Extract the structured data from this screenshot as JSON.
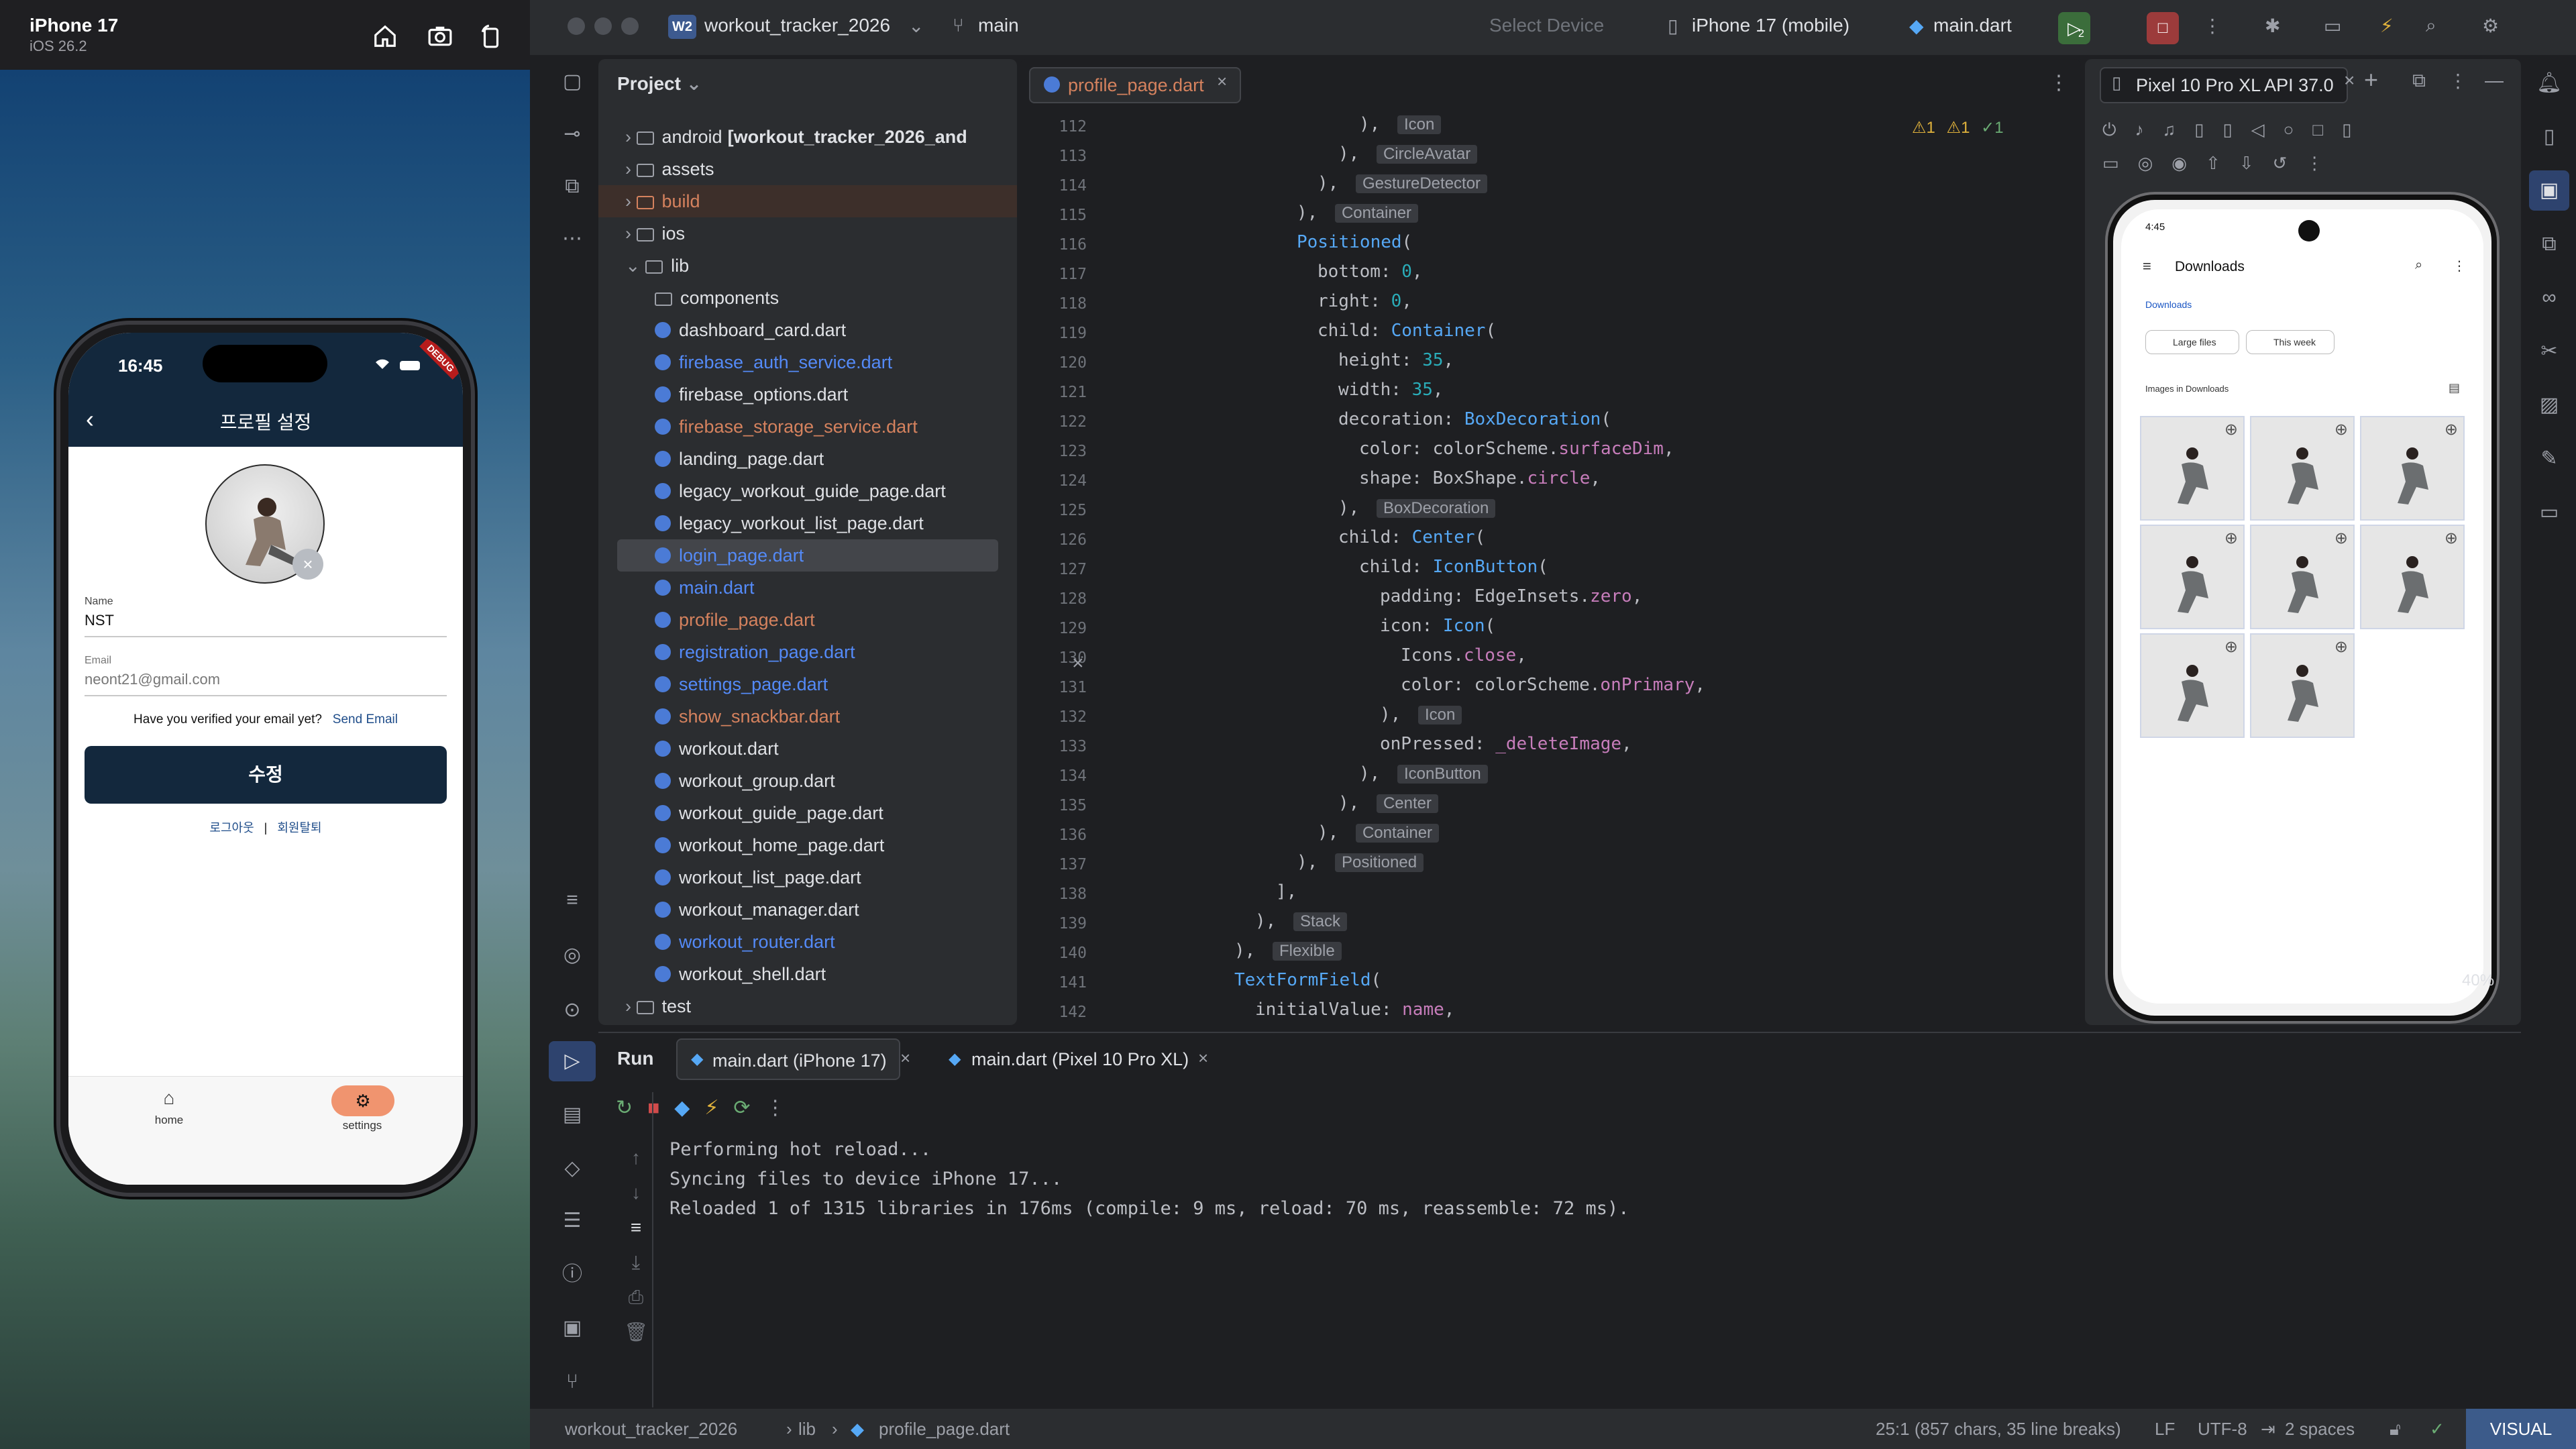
{
  "simulator": {
    "device_name": "iPhone 17",
    "os_version": "iOS 26.2",
    "app": {
      "time": "16:45",
      "debug_banner": "DEBUG",
      "title": "프로필 설정",
      "name_label": "Name",
      "name_value": "NST",
      "email_label": "Email",
      "email_value": "neont21@gmail.com",
      "verify_text": "Have you verified your email yet?",
      "send_email": "Send Email",
      "edit_button": "수정",
      "logout": "로그아웃",
      "separator": "|",
      "withdraw": "회원탈퇴",
      "tabs": [
        {
          "label": "home",
          "icon": "home-icon"
        },
        {
          "label": "settings",
          "icon": "gear-icon"
        }
      ]
    }
  },
  "ide": {
    "project_badge": "W2",
    "project_name": "workout_tracker_2026",
    "branch": "main",
    "select_device": "Select Device",
    "device": "iPhone 17 (mobile)",
    "run_config": "main.dart",
    "badge_count": "2",
    "project_panel": {
      "title": "Project",
      "items": [
        {
          "label": "android",
          "suffix": "[workout_tracker_2026_and",
          "type": "folder",
          "depth": 1,
          "style": "plain"
        },
        {
          "label": "assets",
          "type": "folder",
          "depth": 1,
          "style": "plain"
        },
        {
          "label": "build",
          "type": "folder",
          "depth": 1,
          "style": "orange"
        },
        {
          "label": "ios",
          "type": "folder",
          "depth": 1,
          "style": "plain"
        },
        {
          "label": "lib",
          "type": "folder",
          "depth": 1,
          "style": "plain",
          "open": true
        },
        {
          "label": "components",
          "type": "folder",
          "depth": 2,
          "style": "plain"
        },
        {
          "label": "dashboard_card.dart",
          "type": "dart",
          "depth": 2,
          "style": "plain"
        },
        {
          "label": "firebase_auth_service.dart",
          "type": "dart",
          "depth": 2,
          "style": "blue"
        },
        {
          "label": "firebase_options.dart",
          "type": "dart",
          "depth": 2,
          "style": "plain"
        },
        {
          "label": "firebase_storage_service.dart",
          "type": "dart",
          "depth": 2,
          "style": "mod"
        },
        {
          "label": "landing_page.dart",
          "type": "dart",
          "depth": 2,
          "style": "plain"
        },
        {
          "label": "legacy_workout_guide_page.dart",
          "type": "dart",
          "depth": 2,
          "style": "plain"
        },
        {
          "label": "legacy_workout_list_page.dart",
          "type": "dart",
          "depth": 2,
          "style": "plain"
        },
        {
          "label": "login_page.dart",
          "type": "dart",
          "depth": 2,
          "style": "blue",
          "selected": true
        },
        {
          "label": "main.dart",
          "type": "dart",
          "depth": 2,
          "style": "blue"
        },
        {
          "label": "profile_page.dart",
          "type": "dart",
          "depth": 2,
          "style": "mod"
        },
        {
          "label": "registration_page.dart",
          "type": "dart",
          "depth": 2,
          "style": "blue"
        },
        {
          "label": "settings_page.dart",
          "type": "dart",
          "depth": 2,
          "style": "blue"
        },
        {
          "label": "show_snackbar.dart",
          "type": "dart",
          "depth": 2,
          "style": "mod"
        },
        {
          "label": "workout.dart",
          "type": "dart",
          "depth": 2,
          "style": "plain"
        },
        {
          "label": "workout_group.dart",
          "type": "dart",
          "depth": 2,
          "style": "plain"
        },
        {
          "label": "workout_guide_page.dart",
          "type": "dart",
          "depth": 2,
          "style": "plain"
        },
        {
          "label": "workout_home_page.dart",
          "type": "dart",
          "depth": 2,
          "style": "plain"
        },
        {
          "label": "workout_list_page.dart",
          "type": "dart",
          "depth": 2,
          "style": "plain"
        },
        {
          "label": "workout_manager.dart",
          "type": "dart",
          "depth": 2,
          "style": "plain"
        },
        {
          "label": "workout_router.dart",
          "type": "dart",
          "depth": 2,
          "style": "blue"
        },
        {
          "label": "workout_shell.dart",
          "type": "dart",
          "depth": 2,
          "style": "plain"
        },
        {
          "label": "test",
          "type": "folder",
          "depth": 1,
          "style": "plain"
        }
      ]
    },
    "editor": {
      "tab": "profile_page.dart",
      "inspections": {
        "warn1": "1",
        "warn2": "1",
        "ok": "1"
      },
      "lines": [
        "112",
        "113",
        "114",
        "115",
        "116",
        "117",
        "118",
        "119",
        "120",
        "121",
        "122",
        "123",
        "124",
        "125",
        "126",
        "127",
        "128",
        "129",
        "130",
        "131",
        "132",
        "133",
        "134",
        "135",
        "136",
        "137",
        "138",
        "139",
        "140",
        "141",
        "142"
      ],
      "hints": [
        "Icon",
        "CircleAvatar",
        "GestureDetector",
        "Container",
        "BoxDecoration",
        "Icon",
        "IconButton",
        "Center",
        "Container",
        "Positioned",
        "Stack",
        "Flexible"
      ]
    },
    "emulator": {
      "tab": "Pixel 10 Pro XL API 37.0",
      "zoom": "40%",
      "android": {
        "time": "4:45",
        "title": "Downloads",
        "breadcrumb": "Downloads",
        "chip1": "Large files",
        "chip2": "This week",
        "section": "Images in Downloads",
        "image_count": 8
      }
    },
    "run": {
      "header": "Run",
      "tab1": "main.dart (iPhone 17)",
      "tab2": "main.dart (Pixel 10 Pro XL)",
      "console": [
        "Performing hot reload...",
        "Syncing files to device iPhone 17...",
        "Reloaded 1 of 1315 libraries in 176ms (compile: 9 ms, reload: 70 ms, reassemble: 72 ms)."
      ]
    },
    "status": {
      "path1": "workout_tracker_2026",
      "path2": "lib",
      "path3": "profile_page.dart",
      "position": "25:1 (857 chars, 35 line breaks)",
      "line_ending": "LF",
      "encoding": "UTF-8",
      "indent": "2 spaces",
      "mode": "VISUAL"
    }
  }
}
